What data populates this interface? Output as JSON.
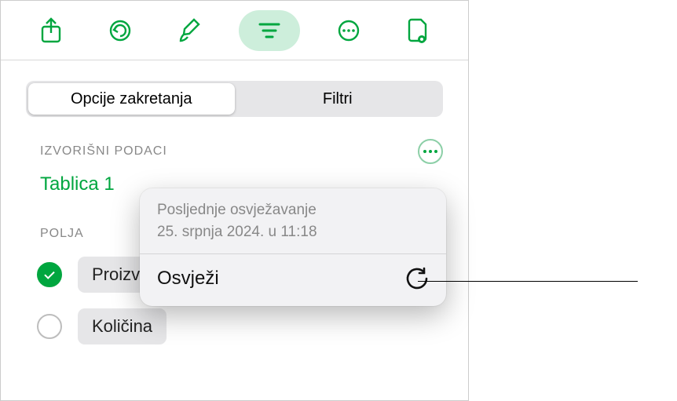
{
  "toolbar": {
    "share_icon": "share-icon",
    "undo_icon": "undo-icon",
    "format_icon": "paintbrush-icon",
    "filter_icon": "lines-icon",
    "more_icon": "ellipsis-icon",
    "insert_icon": "document-icon"
  },
  "tabs": {
    "pivot": "Opcije zakretanja",
    "filters": "Filtri"
  },
  "source_section_label": "IZVORIŠNI PODACI",
  "table_name": "Tablica 1",
  "fields_section_label": "POLJA",
  "fields": [
    {
      "label": "Proizvod",
      "checked": true
    },
    {
      "label": "Količina",
      "checked": false
    }
  ],
  "popover": {
    "last_refresh_line1": "Posljednje osvježavanje",
    "last_refresh_line2": "25. srpnja 2024. u 11:18",
    "refresh_label": "Osvježi"
  },
  "colors": {
    "accent": "#00a63f"
  }
}
